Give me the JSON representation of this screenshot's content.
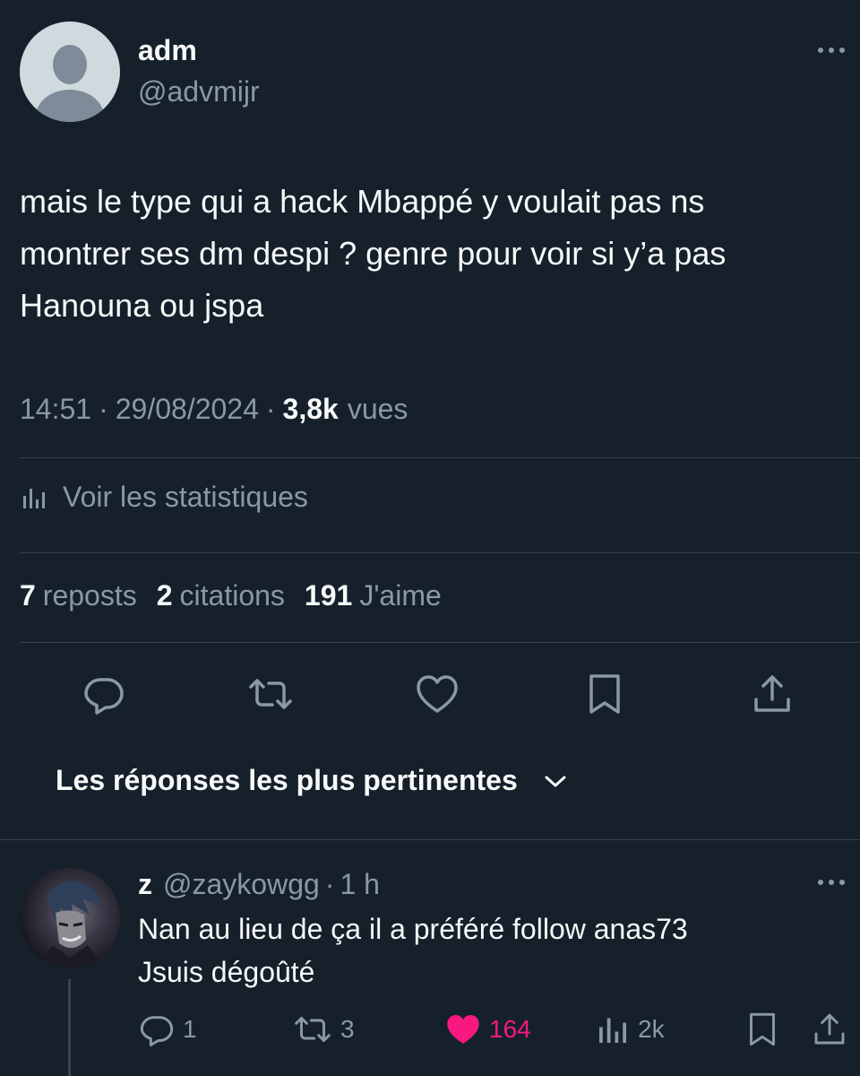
{
  "post": {
    "author_name": "adm",
    "author_handle": "@advmijr",
    "text": "mais le type qui a hack Mbappé y voulait pas ns\nmontrer ses dm despi ? genre pour voir si y’a pas\nHanouna ou jspa",
    "time": "14:51",
    "dot": "·",
    "date": "29/08/2024",
    "views_count": "3,8k",
    "views_label": "vues",
    "stats_link": "Voir les statistiques",
    "reposts_count": "7",
    "reposts_label": "reposts",
    "quotes_count": "2",
    "quotes_label": "citations",
    "likes_count": "191",
    "likes_label": "J'aime"
  },
  "actions": {
    "icons": [
      "reply-icon",
      "repost-icon",
      "like-icon",
      "bookmark-icon",
      "share-icon"
    ]
  },
  "replies_sort": {
    "label": "Les réponses les plus pertinentes"
  },
  "reply": {
    "author_name": "z",
    "author_handle": "@zaykowgg",
    "dot": "·",
    "age": "1 h",
    "text": "Nan au lieu de ça il a préféré follow anas73\nJsuis dégoûté",
    "reply_count": "1",
    "repost_count": "3",
    "like_count": "164",
    "views_count": "2k"
  },
  "colors": {
    "background": "#15202b",
    "text": "#f7f9f9",
    "muted": "#8b98a5",
    "divider": "#38444d",
    "like_active": "#f91880"
  }
}
